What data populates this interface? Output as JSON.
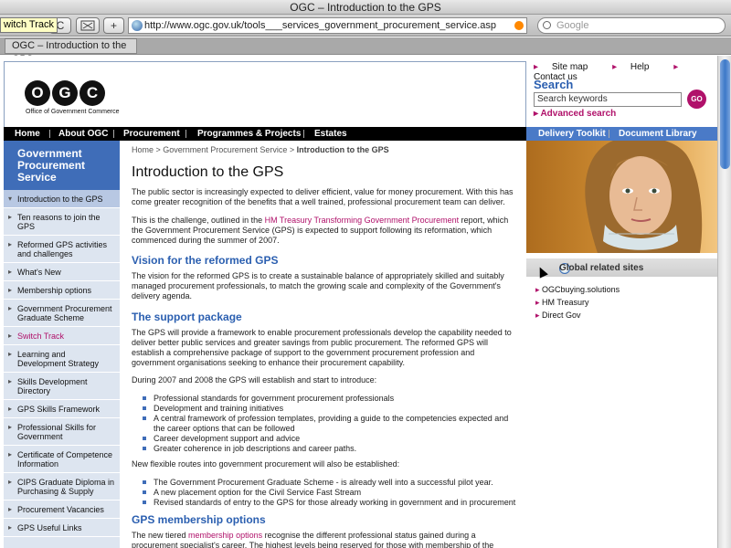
{
  "window": {
    "title": "OGC – Introduction to the GPS"
  },
  "toolbar": {
    "tooltip": "witch Track",
    "reload_glyph": "C",
    "add_glyph": "+",
    "url": "http://www.ogc.gov.uk/tools___services_government_procurement_service.asp",
    "search_placeholder": "Google"
  },
  "tab": {
    "label": "OGC – Introduction to the GPS"
  },
  "header": {
    "logo": {
      "letters": [
        "O",
        "G",
        "C"
      ],
      "subtitle": "Office of Government Commerce"
    },
    "links": [
      "Site map",
      "Help",
      "Contact us"
    ],
    "search_label": "Search",
    "search_placeholder": "Search keywords",
    "go_label": "GO",
    "advanced_search": "Advanced search"
  },
  "nav": {
    "items": [
      "Home",
      "About OGC",
      "Procurement",
      "Programmes & Projects",
      "Estates"
    ],
    "right_items": [
      "Delivery Toolkit",
      "Document Library"
    ]
  },
  "sidebar": {
    "title": "Government Procurement Service",
    "items": [
      {
        "label": "Introduction to the GPS"
      },
      {
        "label": "Ten reasons to join the GPS"
      },
      {
        "label": "Reformed GPS activities and challenges"
      },
      {
        "label": "What's New"
      },
      {
        "label": "Membership options"
      },
      {
        "label": "Government Procurement Graduate Scheme"
      },
      {
        "label": "Switch Track"
      },
      {
        "label": "Learning and Development Strategy"
      },
      {
        "label": "Skills Development Directory"
      },
      {
        "label": "GPS Skills Framework"
      },
      {
        "label": "Professional Skills for Government"
      },
      {
        "label": "Certificate of Competence Information"
      },
      {
        "label": "CIPS Graduate Diploma in Purchasing & Supply"
      },
      {
        "label": "Procurement Vacancies"
      },
      {
        "label": "GPS Useful Links"
      }
    ]
  },
  "main": {
    "breadcrumb": {
      "home": "Home",
      "sep": " > ",
      "parent": "Government Procurement Service",
      "current": "Introduction to the GPS"
    },
    "title": "Introduction to the GPS",
    "p1": "The public sector is increasingly expected to deliver efficient, value for money procurement. With this has come greater recognition of the benefits that a well trained, professional procurement team can deliver.",
    "p2_before": "This is the challenge, outlined in the ",
    "p2_link": "HM Treasury Transforming Government Procurement",
    "p2_after": " report, which the Government Procurement Service (GPS) is expected to support following its reformation, which commenced during the summer of 2007.",
    "h_vision": "Vision for the reformed GPS",
    "p3": "The vision for the reformed GPS is to create a sustainable balance of appropriately skilled and suitably managed procurement professionals, to match the growing scale and complexity of the Government's delivery agenda.",
    "h_support": "The support package",
    "p4": "The GPS will provide a framework to enable procurement professionals develop the capability needed to deliver better public services and greater savings from public procurement. The reformed GPS will establish a comprehensive package of support to the government procurement profession and government organisations seeking to enhance their procurement capability.",
    "p5": "During 2007 and 2008 the GPS will establish and start to introduce:",
    "bullets1": [
      "Professional standards for government procurement professionals",
      "Development and training initiatives",
      "A central framework of profession templates, providing a guide to the competencies expected and the career options that can be followed",
      "Career development support and advice",
      "Greater coherence in job descriptions and career paths."
    ],
    "p6": "New flexible routes into government procurement will also be established:",
    "bullets2": [
      "The Government Procurement Graduate Scheme - is already well into a successful pilot year.",
      "A new placement option for the Civil Service Fast Stream",
      "Revised standards of entry to the GPS for those already working in government and in procurement"
    ],
    "h_membership": "GPS membership options",
    "p7_before": "The new tiered ",
    "p7_link": "membership options",
    "p7_after": " recognise the different professional status gained during a procurement specialist's career. The highest levels being reserved for those with membership of the Chartered Institute"
  },
  "right": {
    "global_title": "Global related sites",
    "links": [
      "OGCbuying.solutions",
      "HM Treasury",
      "Direct Gov"
    ]
  },
  "colors": {
    "accent_blue": "#3f6db8",
    "link_pink": "#b0116a",
    "heading_blue": "#2b5fb0"
  }
}
